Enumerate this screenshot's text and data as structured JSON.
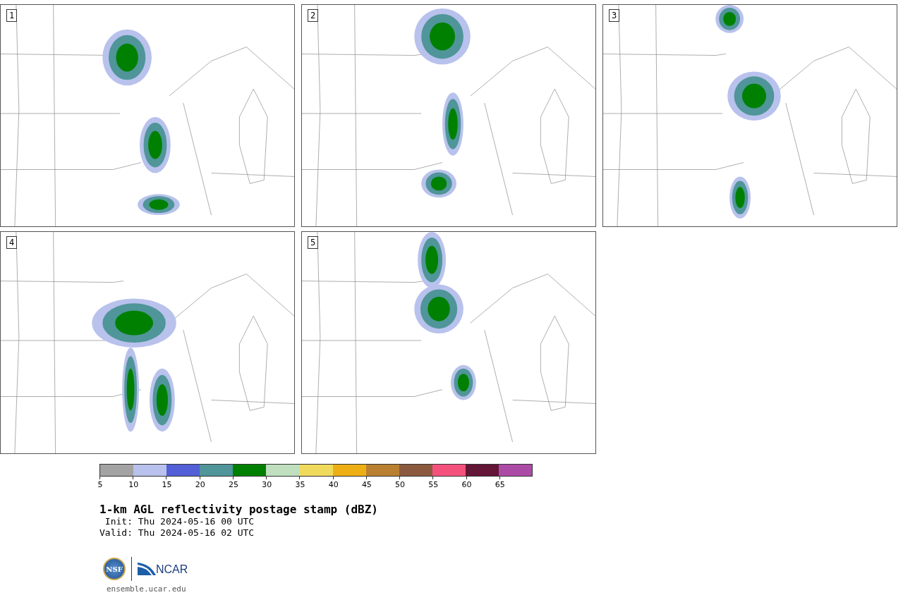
{
  "panels": [
    {
      "label": "1"
    },
    {
      "label": "2"
    },
    {
      "label": "3"
    },
    {
      "label": "4"
    },
    {
      "label": "5"
    }
  ],
  "colorbar": {
    "segments": [
      {
        "color": "#a3a3a3"
      },
      {
        "color": "#b8c2ec"
      },
      {
        "color": "#525fd6"
      },
      {
        "color": "#4f9599"
      },
      {
        "color": "#008000"
      },
      {
        "color": "#bfdfbf"
      },
      {
        "color": "#f0da5c"
      },
      {
        "color": "#eeaf14"
      },
      {
        "color": "#b98032"
      },
      {
        "color": "#8b5a3e"
      },
      {
        "color": "#f5517d"
      },
      {
        "color": "#631635"
      },
      {
        "color": "#ac4ba6"
      }
    ],
    "ticks": [
      "5",
      "10",
      "15",
      "20",
      "25",
      "30",
      "35",
      "40",
      "45",
      "50",
      "55",
      "60",
      "65"
    ]
  },
  "title": "1-km AGL reflectivity postage stamp (dBZ)",
  "init": " Init: Thu 2024-05-16 00 UTC",
  "valid": "Valid: Thu 2024-05-16 02 UTC",
  "logos": {
    "nsf": "NSF",
    "ncar": "NCAR"
  },
  "site": "ensemble.ucar.edu"
}
